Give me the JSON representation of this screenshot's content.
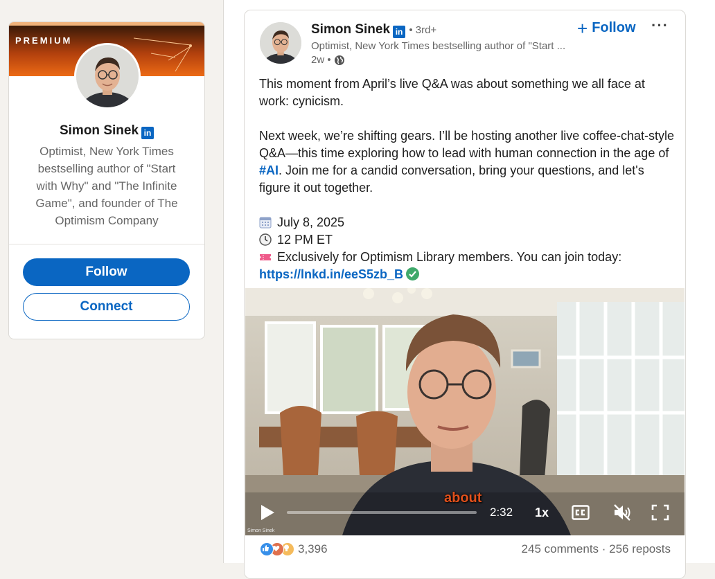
{
  "profile_card": {
    "banner_label": "PREMIUM",
    "name": "Simon Sinek",
    "li_badge": "in",
    "headline": "Optimist, New York Times bestselling author of \"Start with Why\" and \"The Infinite Game\", and founder of The Optimism Company",
    "follow_label": "Follow",
    "connect_label": "Connect"
  },
  "post": {
    "author_name": "Simon Sinek",
    "li_badge": "in",
    "degree": "• 3rd+",
    "headline": "Optimist, New York Times bestselling author of \"Start ...",
    "time": "2w •",
    "follow_label": "Follow",
    "more_label": "···",
    "body": {
      "p1": "This moment from April’s live Q&A was about something we all face at work: cynicism.",
      "p2_before": "Next week, we’re shifting gears. I’ll be hosting another live coffee-chat-style Q&A—this time exploring how to lead with human connection in the age of ",
      "hashtag": "#AI",
      "p2_after": ". Join me for a candid conversation, bring your questions, and let's figure it out together.",
      "date": "July 8, 2025",
      "time": "12 PM ET",
      "exclusive": "Exclusively for Optimism Library members. You can join today: ",
      "link": "https://lnkd.in/eeS5zb_B"
    },
    "video": {
      "caption": "about",
      "time": "2:32",
      "speed": "1x",
      "progress": 0.0,
      "watermark": "Simon Sinek"
    },
    "reactions_count": "3,396",
    "comments_reposts": "245 comments · 256 reposts"
  },
  "colors": {
    "linkedin_blue": "#0a66c2",
    "premium_orange": "#e8640f",
    "caption_orange": "#e0501c",
    "check_green": "#3fa96b"
  }
}
